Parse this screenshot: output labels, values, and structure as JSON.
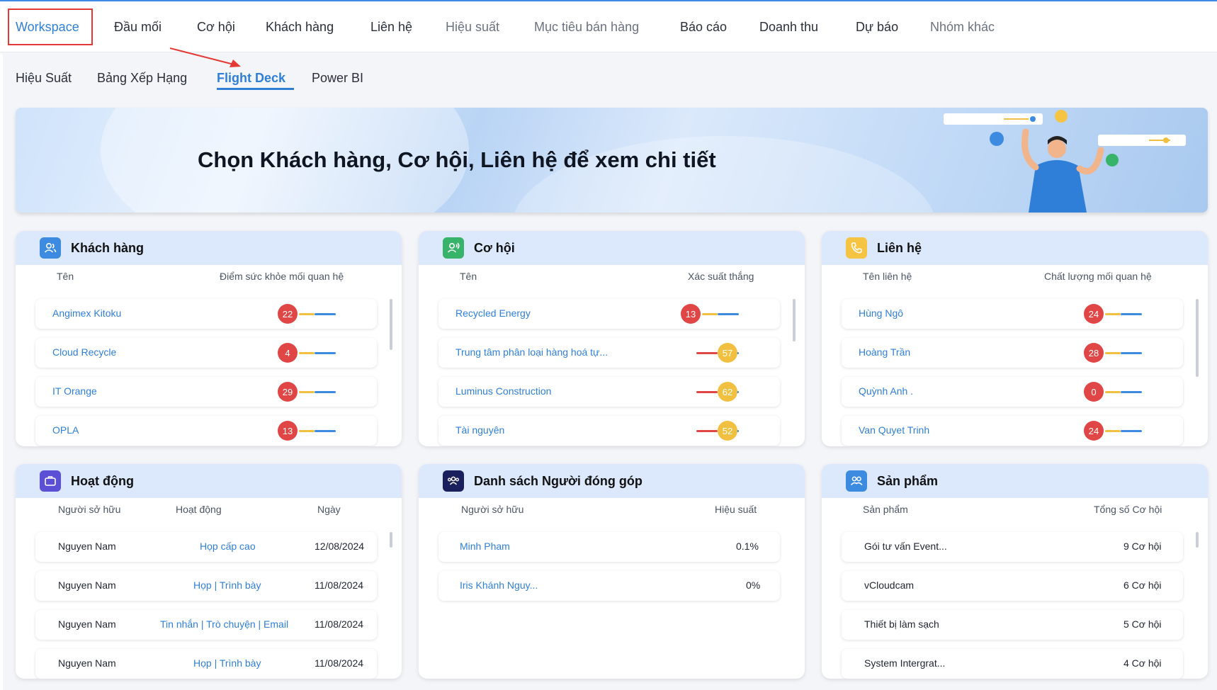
{
  "topnav": {
    "items": [
      "Workspace",
      "Đầu mối",
      "Cơ hội",
      "Khách hàng",
      "Liên hệ",
      "Hiệu suất",
      "Mục tiêu bán hàng",
      "Báo cáo",
      "Doanh thu",
      "Dự báo",
      "Nhóm khác"
    ]
  },
  "subtabs": [
    "Hiệu Suất",
    "Bảng Xếp Hạng",
    "Flight Deck",
    "Power BI"
  ],
  "banner": {
    "title": "Chọn Khách hàng, Cơ hội, Liên hệ để xem chi tiết"
  },
  "customers": {
    "title": "Khách hàng",
    "col_name": "Tên",
    "col_score": "Điểm sức khỏe mối quan hệ",
    "rows": [
      {
        "name": "Angimex Kitoku",
        "score": "22"
      },
      {
        "name": "Cloud Recycle",
        "score": "4"
      },
      {
        "name": "IT Orange",
        "score": "29"
      },
      {
        "name": "OPLA",
        "score": "13"
      }
    ]
  },
  "opportunities": {
    "title": "Cơ hội",
    "col_name": "Tên",
    "col_score": "Xác suất thắng",
    "rows": [
      {
        "name": "Recycled Energy",
        "score": "13"
      },
      {
        "name": "Trung tâm phân loại hàng hoá tự...",
        "score": "57"
      },
      {
        "name": "Luminus Construction",
        "score": "62"
      },
      {
        "name": "Tài nguyên",
        "score": "52"
      }
    ]
  },
  "contacts": {
    "title": "Liên hệ",
    "col_name": "Tên liên hệ",
    "col_score": "Chất lượng mối quan hệ",
    "rows": [
      {
        "name": "Hùng Ngô",
        "score": "24"
      },
      {
        "name": "Hoàng Trần",
        "score": "28"
      },
      {
        "name": "Quỳnh Anh .",
        "score": "0"
      },
      {
        "name": "Van Quyet Trinh",
        "score": "24"
      }
    ]
  },
  "activities": {
    "title": "Hoạt động",
    "col_owner": "Người sở hữu",
    "col_activity": "Hoạt động",
    "col_date": "Ngày",
    "rows": [
      {
        "owner": "Nguyen Nam",
        "activity": "Họp cấp cao",
        "date": "12/08/2024"
      },
      {
        "owner": "Nguyen Nam",
        "activity": "Họp | Trình bày",
        "date": "11/08/2024"
      },
      {
        "owner": "Nguyen Nam",
        "activity": "Tin nhắn | Trò chuyện | Email",
        "date": "11/08/2024"
      },
      {
        "owner": "Nguyen Nam",
        "activity": "Họp | Trình bày",
        "date": "11/08/2024"
      }
    ]
  },
  "contributors": {
    "title": "Danh sách Người đóng góp",
    "col_owner": "Người sở hữu",
    "col_perf": "Hiệu suất",
    "rows": [
      {
        "name": "Minh Pham",
        "perf": "0.1%"
      },
      {
        "name": "Iris Khánh Nguy...",
        "perf": "0%"
      }
    ]
  },
  "products": {
    "title": "Sản phẩm",
    "col_product": "Sản phẩm",
    "col_total": "Tổng số Cơ hội",
    "rows": [
      {
        "name": "Gói tư vấn Event...",
        "total": "9 Cơ hội"
      },
      {
        "name": "vCloudcam",
        "total": "6 Cơ hội"
      },
      {
        "name": "Thiết bị làm sạch",
        "total": "5 Cơ hội"
      },
      {
        "name": "System Intergrat...",
        "total": "4 Cơ hội"
      }
    ]
  },
  "colors": {
    "accent": "#2f7fd8",
    "score_red": "#e04646",
    "score_yellow": "#f2c040",
    "header_bg": "#dce8fb"
  }
}
